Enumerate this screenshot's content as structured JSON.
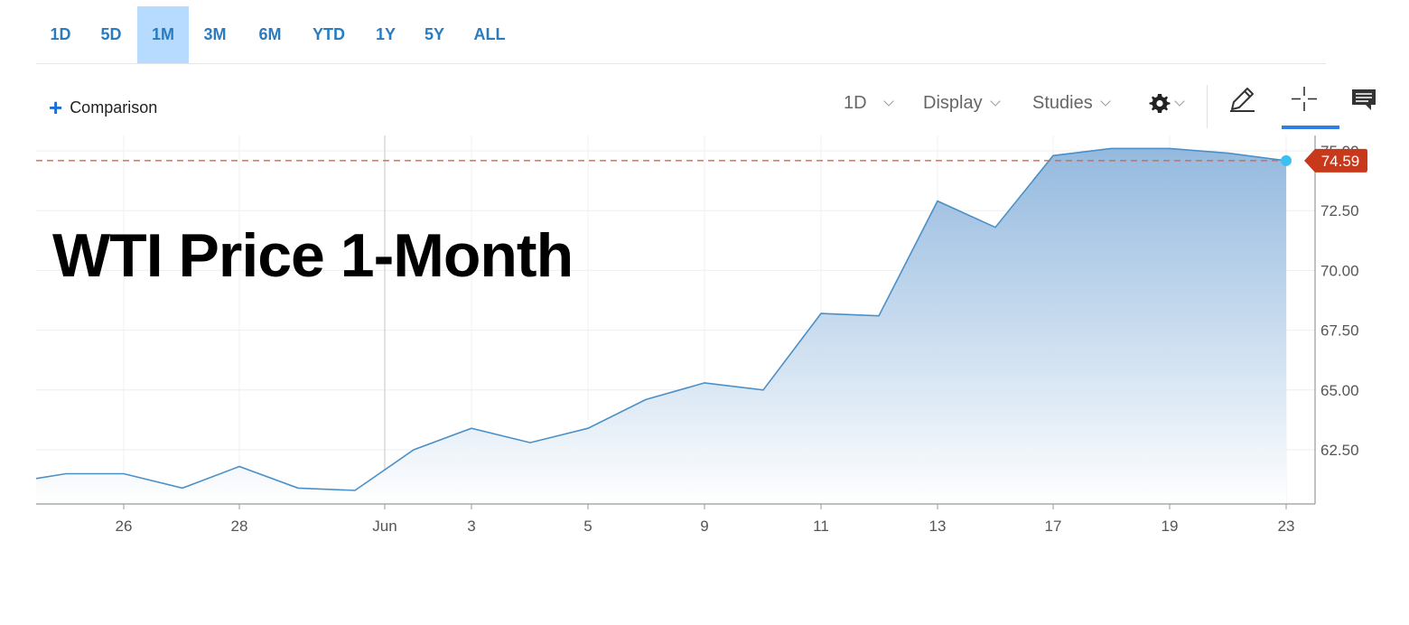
{
  "range_tabs": [
    {
      "label": "1D",
      "active": false
    },
    {
      "label": "5D",
      "active": false
    },
    {
      "label": "1M",
      "active": true
    },
    {
      "label": "3M",
      "active": false
    },
    {
      "label": "6M",
      "active": false
    },
    {
      "label": "YTD",
      "active": false
    },
    {
      "label": "1Y",
      "active": false
    },
    {
      "label": "5Y",
      "active": false
    },
    {
      "label": "ALL",
      "active": false
    }
  ],
  "toolbar": {
    "comparison_label": "Comparison",
    "interval_label": "1D",
    "display_label": "Display",
    "studies_label": "Studies",
    "icons": [
      "gear-icon",
      "pencil-icon",
      "crosshair-icon",
      "comment-icon"
    ]
  },
  "headline": "WTI Price 1-Month",
  "colors": {
    "line": "#4a90c8",
    "area_top": "#8fb6dd",
    "last_price_line": "#d2694a",
    "last_price_badge": "#c8391c",
    "last_point": "#3cc0f0",
    "tab_text": "#2a7bc0",
    "tab_active_bg": "#b6dbff"
  },
  "chart_data": {
    "type": "area",
    "title": "",
    "xlabel": "",
    "ylabel": "",
    "x_tick_labels": [
      "26",
      "28",
      "Jun",
      "3",
      "5",
      "9",
      "11",
      "13",
      "17",
      "19",
      "23"
    ],
    "y_tick_labels": [
      "62.50",
      "65.00",
      "67.50",
      "70.00",
      "72.50",
      "75.00"
    ],
    "ylim": [
      60.3,
      75.3
    ],
    "grid": true,
    "last_price_label": "74.59",
    "series": [
      {
        "values": [
          {
            "x": "May 24",
            "y": 61.3
          },
          {
            "x": "May 25",
            "y": 61.5
          },
          {
            "x": "May 26",
            "y": 61.5
          },
          {
            "x": "May 27",
            "y": 60.9
          },
          {
            "x": "May 28",
            "y": 61.8
          },
          {
            "x": "May 29",
            "y": 60.9
          },
          {
            "x": "May 31",
            "y": 60.8
          },
          {
            "x": "Jun 2",
            "y": 62.5
          },
          {
            "x": "Jun 3",
            "y": 63.4
          },
          {
            "x": "Jun 4",
            "y": 62.8
          },
          {
            "x": "Jun 5",
            "y": 63.4
          },
          {
            "x": "Jun 6",
            "y": 64.6
          },
          {
            "x": "Jun 9",
            "y": 65.3
          },
          {
            "x": "Jun 10",
            "y": 65.0
          },
          {
            "x": "Jun 11",
            "y": 68.2
          },
          {
            "x": "Jun 12",
            "y": 68.1
          },
          {
            "x": "Jun 13",
            "y": 72.9
          },
          {
            "x": "Jun 16",
            "y": 71.8
          },
          {
            "x": "Jun 17",
            "y": 74.8
          },
          {
            "x": "Jun 18",
            "y": 75.1
          },
          {
            "x": "Jun 19",
            "y": 75.1
          },
          {
            "x": "Jun 20",
            "y": 74.9
          },
          {
            "x": "Jun 23",
            "y": 74.59
          }
        ]
      }
    ]
  }
}
